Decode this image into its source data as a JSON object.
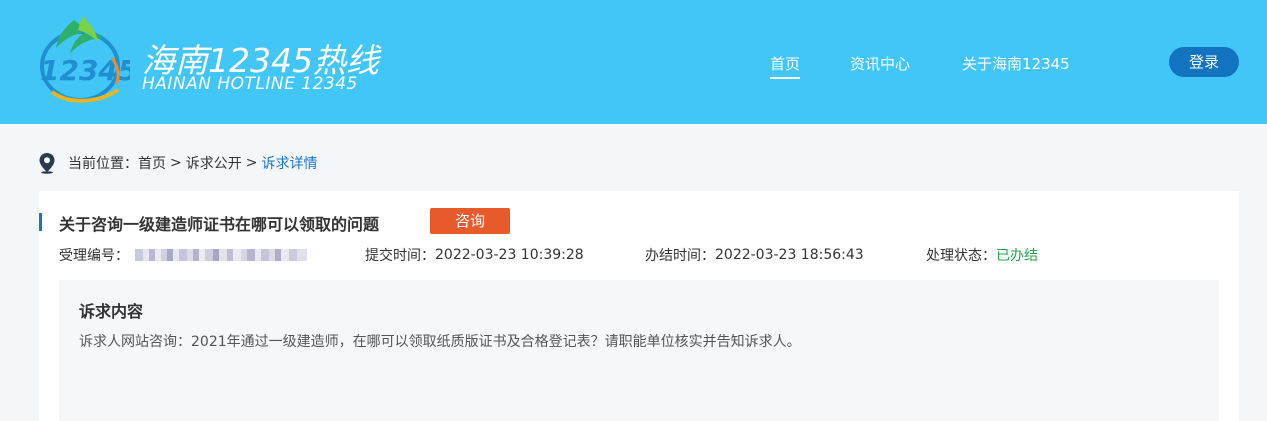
{
  "header": {
    "logo_text_cn": "海南12345热线",
    "logo_text_en": "HAINAN HOTLINE 12345",
    "logo_mark_text": "12345",
    "nav": [
      {
        "label": "首页",
        "active": true
      },
      {
        "label": "资讯中心",
        "active": false
      },
      {
        "label": "关于海南12345",
        "active": false
      }
    ],
    "login_label": "登录"
  },
  "breadcrumb": {
    "prefix": "当前位置：",
    "items": [
      "首页",
      "诉求公开",
      "诉求详情"
    ],
    "separator": ">"
  },
  "detail": {
    "title": "关于咨询一级建造师证书在哪可以领取的问题",
    "tag": "咨询",
    "case_no_label": "受理编号：",
    "submit_label": "提交时间：",
    "submit_time": "2022-03-23 10:39:28",
    "finish_label": "办结时间：",
    "finish_time": "2022-03-23 18:56:43",
    "status_label": "处理状态：",
    "status": "已办结",
    "content_title": "诉求内容",
    "content_text": "诉求人网站咨询：2021年通过一级建造师，在哪可以领取纸质版证书及合格登记表？请职能单位核实并告知诉求人。"
  },
  "colors": {
    "header_bg": "#42c6f7",
    "accent_blue": "#1976c6",
    "login_button": "#1273c0",
    "tag_orange": "#e85a2c",
    "status_green": "#27a050"
  }
}
